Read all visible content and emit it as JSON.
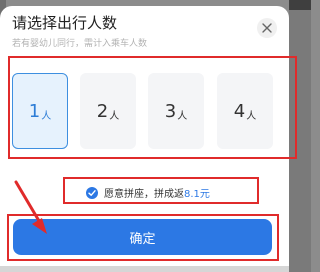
{
  "dialog": {
    "title": "请选择出行人数",
    "subtitle": "若有婴幼儿同行，需计入乘车人数"
  },
  "seats": [
    {
      "num": "1",
      "unit": "人",
      "selected": true
    },
    {
      "num": "2",
      "unit": "人",
      "selected": false
    },
    {
      "num": "3",
      "unit": "人",
      "selected": false
    },
    {
      "num": "4",
      "unit": "人",
      "selected": false
    }
  ],
  "pool": {
    "label": "愿意拼座，拼成返",
    "amount": "8.1元",
    "checked": true
  },
  "confirm": {
    "label": "确定"
  },
  "icons": {
    "close": "close-icon",
    "check": "check-icon",
    "arrow": "arrow-annotation"
  },
  "colors": {
    "accent": "#2c78e4",
    "annotation": "#e02b2b",
    "selected_bg": "#e6f2fd"
  }
}
